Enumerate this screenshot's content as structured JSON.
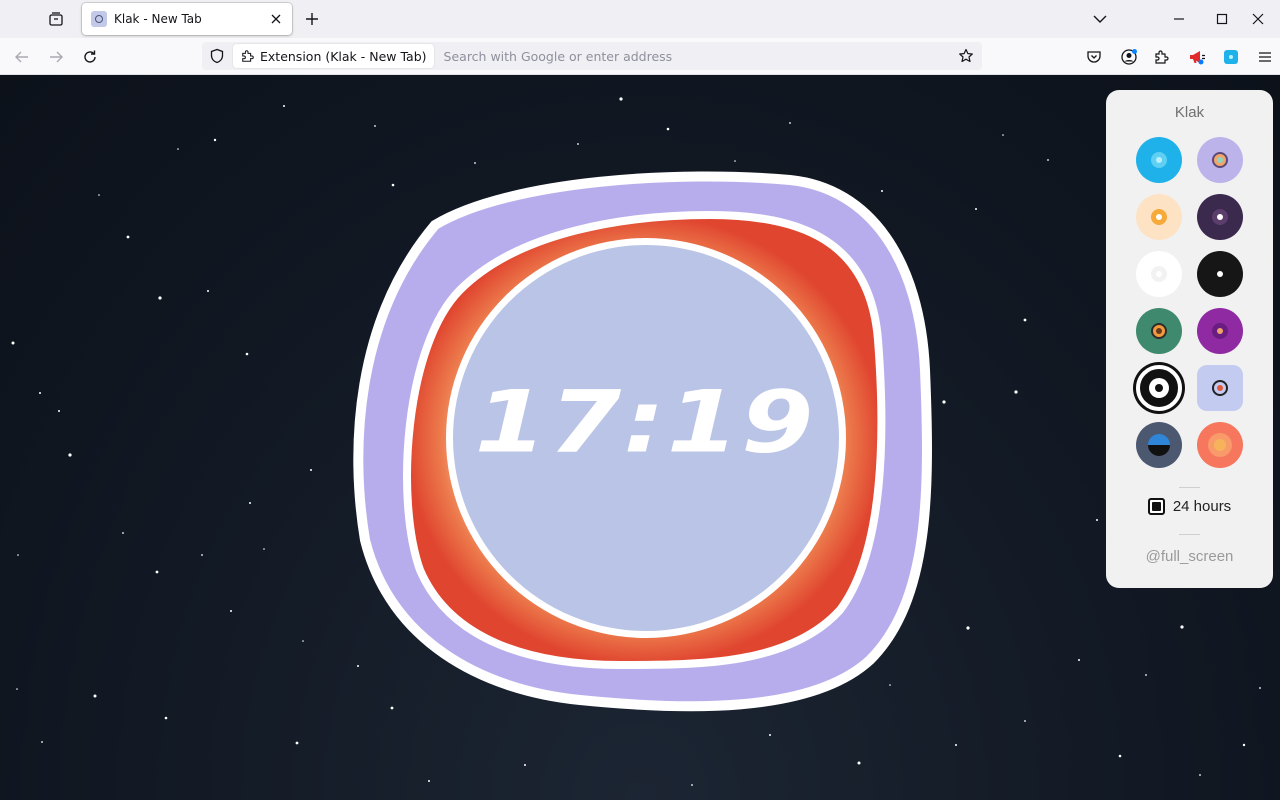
{
  "browser": {
    "tab": {
      "title": "Klak - New Tab"
    },
    "urlbar": {
      "identity_label": "Extension (Klak - New Tab)",
      "placeholder": "Search with Google or enter address"
    }
  },
  "clock": {
    "time": "17:19",
    "colors": {
      "outer": "#b8adec",
      "band_outer": "#e5533a",
      "band_inner": "#f6c9a4",
      "face": "#bac4e6",
      "text": "#ffffff"
    }
  },
  "panel": {
    "title": "Klak",
    "themes": [
      {
        "bg": "#1eb1ea",
        "ring": "#5fd0f3",
        "dot": "#b8f0ff",
        "ring_border": ""
      },
      {
        "bg": "#bcb3ea",
        "ring": "#f2a46a",
        "dot": "#8fd3c3",
        "ring_border": "#5a4a7a"
      },
      {
        "bg": "#fde3c3",
        "ring": "#f7a93a",
        "dot": "#ffffff",
        "ring_border": ""
      },
      {
        "bg": "#3b2a4e",
        "ring": "#5b3e6c",
        "dot": "#ffffff",
        "ring_border": ""
      },
      {
        "bg": "#ffffff",
        "ring": "#f2f2f2",
        "dot": "#ffffff",
        "ring_border": ""
      },
      {
        "bg": "#161616",
        "ring": "#161616",
        "dot": "#ffffff",
        "ring_border": ""
      },
      {
        "bg": "#3f8a6e",
        "ring": "#f39a3d",
        "dot": "#6b3a1e",
        "ring_border": "#2d2d2d"
      },
      {
        "bg": "#8f2aa3",
        "ring": "#6a1d80",
        "dot": "#f0a36a",
        "ring_border": ""
      },
      {
        "bg": "#111111",
        "ring": "#ffffff",
        "dot": "#111111",
        "ring_border": ""
      },
      {
        "bg": "#c4cbf0",
        "ring": "#c4cbf0",
        "dot": "#e25a3b",
        "ring_border": "#222222"
      },
      {
        "bg": "#4b5870",
        "ring": "#2f86d8",
        "dot": "#111111",
        "ring_border": ""
      },
      {
        "bg": "#f6775d",
        "ring": "#f89a6a",
        "dot": "#f7b35b",
        "ring_border": ""
      }
    ],
    "hours_label": "24 hours",
    "fullscreen_label": "@full_screen"
  }
}
